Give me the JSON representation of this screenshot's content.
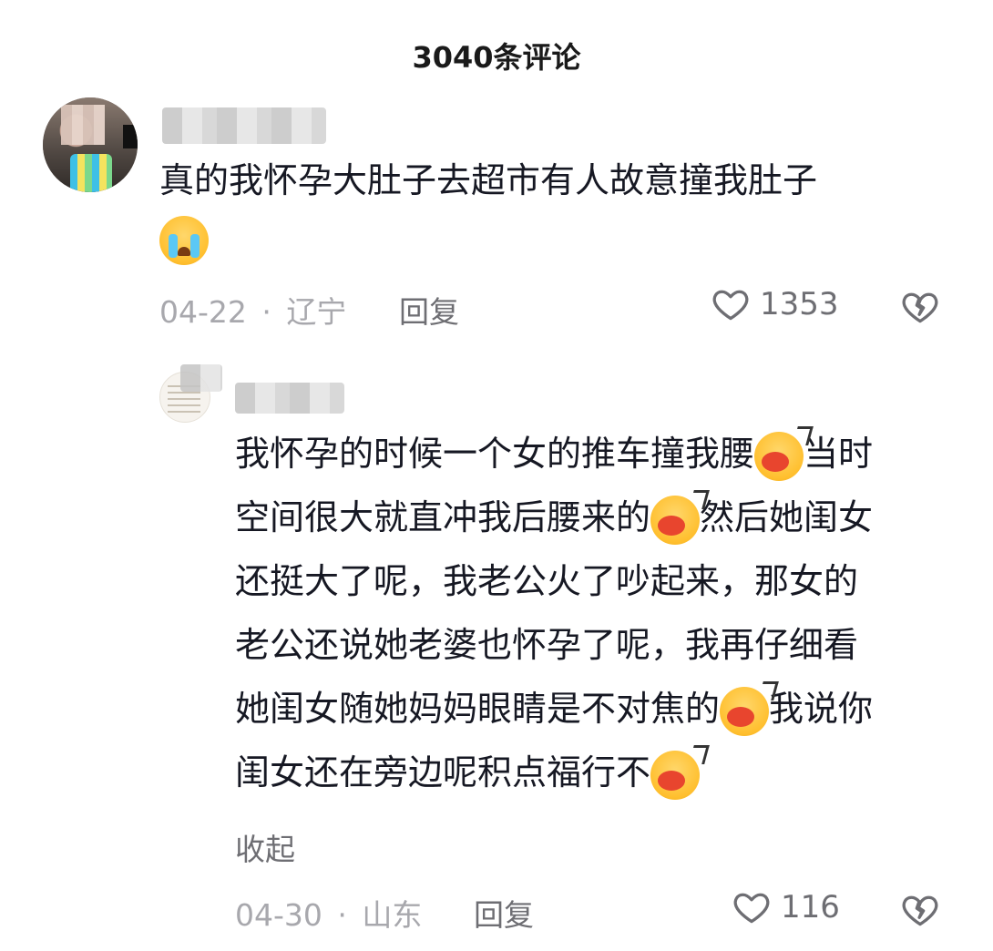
{
  "header": {
    "title": "3040条评论"
  },
  "comments": [
    {
      "text_line1": "真的我怀孕大肚子去超市有人故意撞我肚子",
      "emoji": "loudly-crying-emoji",
      "date": "04-22",
      "separator": "·",
      "location": "辽宁",
      "reply_label": "回复",
      "likes": "1353"
    },
    {
      "lines": [
        "我怀孕的时候一个女的推车撞我腰",
        "当时",
        "空间很大就直冲我后腰来的",
        "然后她闺女",
        "还挺大了呢，我老公火了吵起来，那女的",
        "老公还说她老婆也怀孕了呢，我再仔细看",
        "她闺女随她妈妈眼睛是不对焦的",
        "我说你",
        "闺女还在旁边呢积点福行不"
      ],
      "emoji": "shouting-emoji",
      "collapse_label": "收起",
      "date": "04-30",
      "separator": "·",
      "location": "山东",
      "reply_label": "回复",
      "likes": "116"
    }
  ],
  "colors": {
    "text": "#161823",
    "meta": "#a8a8ad",
    "icon": "#6e6e73"
  }
}
